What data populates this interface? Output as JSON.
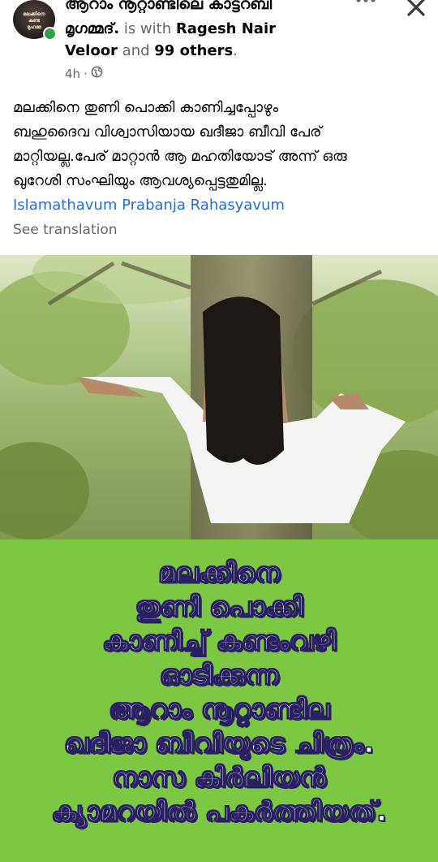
{
  "post": {
    "page_name": "ആറാം നൂറ്റാണ്ടിലെ കാട്ടറബി മൃഗമ്മദ്.",
    "page_name_line1": "ആറാം നൂറ്റാണ്ടിലെ കാട്ടറബി",
    "page_name_line2": "മൃഗമ്മദ്.",
    "is_with": "is with",
    "tagged_name_1": "Ragesh Nair",
    "tagged_name_2": "Veloor",
    "and": "and",
    "others": "99 others",
    "period": ".",
    "time": "4h",
    "dot": "·",
    "avatar_text": [
      "മലക്കിനെ",
      "കണ്ട",
      "മുഹമ്മ"
    ],
    "body": "മലക്കിനെ തുണി പൊക്കി കാണിച്ചപ്പോഴും ബഹുദൈവ വിശ്വാസിയായ ഖദീജാ ബീവി പേര് മാറ്റിയല്ല.പേര് മാറ്റാൻ ആ മഹതിയോട് അന്ന് ഒരു ഖുറേശി സംഘിയും ആവശ്യപ്പെട്ടതുമില്ല.",
    "body_lines": [
      "മലക്കിനെ തുണി പൊക്കി കാണിച്ചപ്പോഴും",
      "ബഹുദൈവ വിശ്വാസിയായ ഖദീജാ ബീവി പേര്",
      "മാറ്റിയല്ല.പേര് മാറ്റാൻ ആ മഹതിയോട് അന്ന് ഒരു",
      "ഖുറേശി സംഘിയും ആവശ്യപ്പെട്ടതുമില്ല."
    ],
    "hashtag": "Islamathavum Prabanja Rahasyavum",
    "see_translation": "See translation"
  },
  "image_overlay": {
    "lines": [
      "മലക്കിനെ",
      "തുണി പൊക്കി",
      "കാണിച്ച് കണ്ടംവഴി",
      "ഓടിക്കുന്ന",
      "ആറാം നൂറ്റാണ്ടില",
      "ഖദീജാ ബീവിയുടെ ചിത്രം.",
      "നാസ കിർലിയൻ",
      "ക്യാമറയിൽ പകർത്തിയത്."
    ],
    "panel_color": "#7dc842",
    "text_color": "#ffffff",
    "outline_color": "#2a1f63"
  },
  "icons": {
    "more": "more-options-icon",
    "close": "close-icon",
    "privacy": "globe-icon"
  },
  "colors": {
    "link": "#216fdb",
    "secondary_text": "#65676b",
    "online": "#31a24c"
  }
}
